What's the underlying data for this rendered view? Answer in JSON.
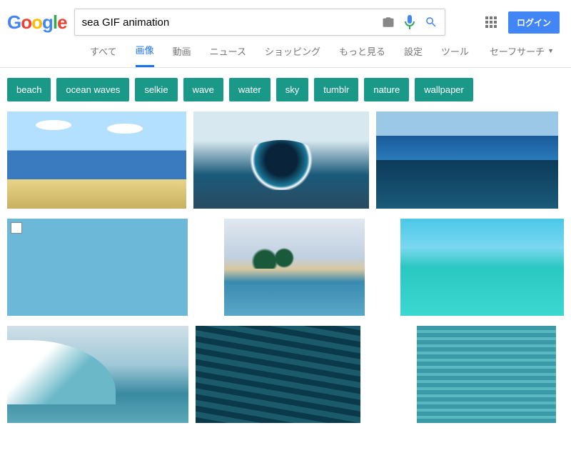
{
  "search": {
    "value": "sea GIF animation"
  },
  "login": "ログイン",
  "nav": {
    "all": "すべて",
    "images": "画像",
    "videos": "動画",
    "news": "ニュース",
    "shopping": "ショッピング",
    "more": "もっと見る",
    "settings": "設定",
    "tools": "ツール",
    "safesearch": "セーフサーチ"
  },
  "chips": [
    "beach",
    "ocean waves",
    "selkie",
    "wave",
    "water",
    "sky",
    "tumblr",
    "nature",
    "wallpaper"
  ]
}
